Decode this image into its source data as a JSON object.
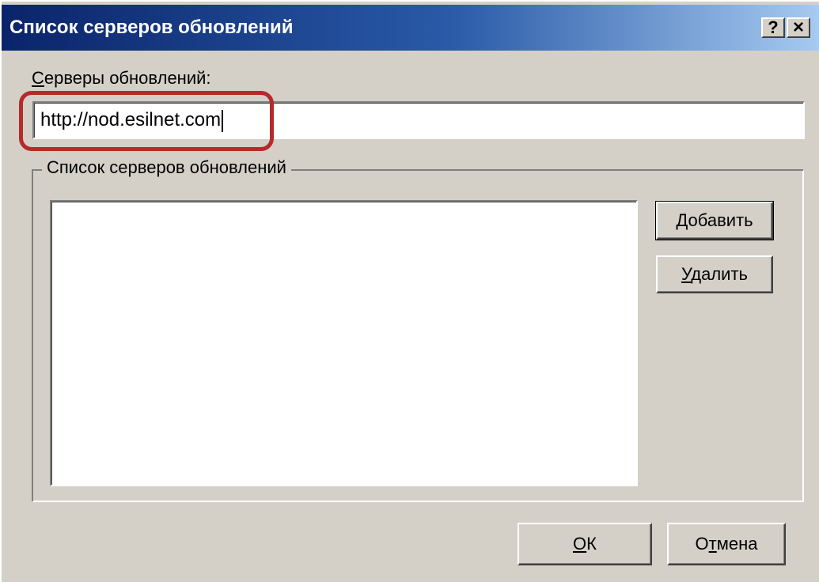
{
  "window": {
    "title": "Список серверов обновлений",
    "help_glyph": "?",
    "close_glyph": "×"
  },
  "servers_field": {
    "label_first": "С",
    "label_rest": "ерверы обновлений:",
    "value": "http://nod.esilnet.com"
  },
  "group": {
    "legend": "Список серверов обновлений",
    "list_items": []
  },
  "buttons": {
    "add_first": "Д",
    "add_rest": "обавить",
    "delete_first": "У",
    "delete_rest": "далить",
    "ok_first": "О",
    "ok_rest": "К",
    "cancel_first": "О",
    "cancel_mid": "т",
    "cancel_rest": "мена"
  },
  "colors": {
    "title_gradient_start": "#0a246a",
    "title_gradient_end": "#a6caf0",
    "dialog_face": "#d4d0c8",
    "highlight_frame": "#b52a2a"
  },
  "icons": {
    "help": "help-icon",
    "close": "close-icon"
  }
}
